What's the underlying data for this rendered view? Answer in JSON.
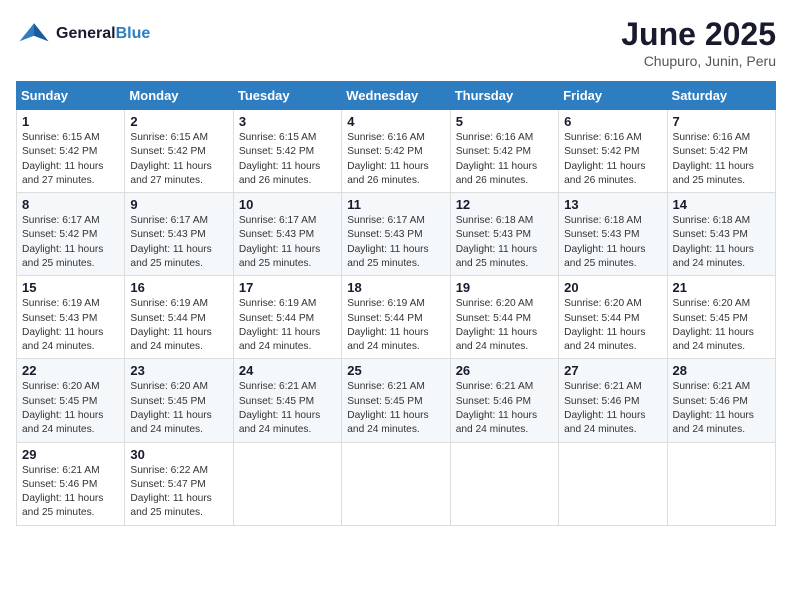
{
  "logo": {
    "line1": "General",
    "line2": "Blue"
  },
  "title": "June 2025",
  "location": "Chupuro, Junin, Peru",
  "days_of_week": [
    "Sunday",
    "Monday",
    "Tuesday",
    "Wednesday",
    "Thursday",
    "Friday",
    "Saturday"
  ],
  "weeks": [
    [
      {
        "day": "1",
        "info": "Sunrise: 6:15 AM\nSunset: 5:42 PM\nDaylight: 11 hours and 27 minutes."
      },
      {
        "day": "2",
        "info": "Sunrise: 6:15 AM\nSunset: 5:42 PM\nDaylight: 11 hours and 27 minutes."
      },
      {
        "day": "3",
        "info": "Sunrise: 6:15 AM\nSunset: 5:42 PM\nDaylight: 11 hours and 26 minutes."
      },
      {
        "day": "4",
        "info": "Sunrise: 6:16 AM\nSunset: 5:42 PM\nDaylight: 11 hours and 26 minutes."
      },
      {
        "day": "5",
        "info": "Sunrise: 6:16 AM\nSunset: 5:42 PM\nDaylight: 11 hours and 26 minutes."
      },
      {
        "day": "6",
        "info": "Sunrise: 6:16 AM\nSunset: 5:42 PM\nDaylight: 11 hours and 26 minutes."
      },
      {
        "day": "7",
        "info": "Sunrise: 6:16 AM\nSunset: 5:42 PM\nDaylight: 11 hours and 25 minutes."
      }
    ],
    [
      {
        "day": "8",
        "info": "Sunrise: 6:17 AM\nSunset: 5:42 PM\nDaylight: 11 hours and 25 minutes."
      },
      {
        "day": "9",
        "info": "Sunrise: 6:17 AM\nSunset: 5:43 PM\nDaylight: 11 hours and 25 minutes."
      },
      {
        "day": "10",
        "info": "Sunrise: 6:17 AM\nSunset: 5:43 PM\nDaylight: 11 hours and 25 minutes."
      },
      {
        "day": "11",
        "info": "Sunrise: 6:17 AM\nSunset: 5:43 PM\nDaylight: 11 hours and 25 minutes."
      },
      {
        "day": "12",
        "info": "Sunrise: 6:18 AM\nSunset: 5:43 PM\nDaylight: 11 hours and 25 minutes."
      },
      {
        "day": "13",
        "info": "Sunrise: 6:18 AM\nSunset: 5:43 PM\nDaylight: 11 hours and 25 minutes."
      },
      {
        "day": "14",
        "info": "Sunrise: 6:18 AM\nSunset: 5:43 PM\nDaylight: 11 hours and 24 minutes."
      }
    ],
    [
      {
        "day": "15",
        "info": "Sunrise: 6:19 AM\nSunset: 5:43 PM\nDaylight: 11 hours and 24 minutes."
      },
      {
        "day": "16",
        "info": "Sunrise: 6:19 AM\nSunset: 5:44 PM\nDaylight: 11 hours and 24 minutes."
      },
      {
        "day": "17",
        "info": "Sunrise: 6:19 AM\nSunset: 5:44 PM\nDaylight: 11 hours and 24 minutes."
      },
      {
        "day": "18",
        "info": "Sunrise: 6:19 AM\nSunset: 5:44 PM\nDaylight: 11 hours and 24 minutes."
      },
      {
        "day": "19",
        "info": "Sunrise: 6:20 AM\nSunset: 5:44 PM\nDaylight: 11 hours and 24 minutes."
      },
      {
        "day": "20",
        "info": "Sunrise: 6:20 AM\nSunset: 5:44 PM\nDaylight: 11 hours and 24 minutes."
      },
      {
        "day": "21",
        "info": "Sunrise: 6:20 AM\nSunset: 5:45 PM\nDaylight: 11 hours and 24 minutes."
      }
    ],
    [
      {
        "day": "22",
        "info": "Sunrise: 6:20 AM\nSunset: 5:45 PM\nDaylight: 11 hours and 24 minutes."
      },
      {
        "day": "23",
        "info": "Sunrise: 6:20 AM\nSunset: 5:45 PM\nDaylight: 11 hours and 24 minutes."
      },
      {
        "day": "24",
        "info": "Sunrise: 6:21 AM\nSunset: 5:45 PM\nDaylight: 11 hours and 24 minutes."
      },
      {
        "day": "25",
        "info": "Sunrise: 6:21 AM\nSunset: 5:45 PM\nDaylight: 11 hours and 24 minutes."
      },
      {
        "day": "26",
        "info": "Sunrise: 6:21 AM\nSunset: 5:46 PM\nDaylight: 11 hours and 24 minutes."
      },
      {
        "day": "27",
        "info": "Sunrise: 6:21 AM\nSunset: 5:46 PM\nDaylight: 11 hours and 24 minutes."
      },
      {
        "day": "28",
        "info": "Sunrise: 6:21 AM\nSunset: 5:46 PM\nDaylight: 11 hours and 24 minutes."
      }
    ],
    [
      {
        "day": "29",
        "info": "Sunrise: 6:21 AM\nSunset: 5:46 PM\nDaylight: 11 hours and 25 minutes."
      },
      {
        "day": "30",
        "info": "Sunrise: 6:22 AM\nSunset: 5:47 PM\nDaylight: 11 hours and 25 minutes."
      },
      {
        "day": "",
        "info": ""
      },
      {
        "day": "",
        "info": ""
      },
      {
        "day": "",
        "info": ""
      },
      {
        "day": "",
        "info": ""
      },
      {
        "day": "",
        "info": ""
      }
    ]
  ]
}
